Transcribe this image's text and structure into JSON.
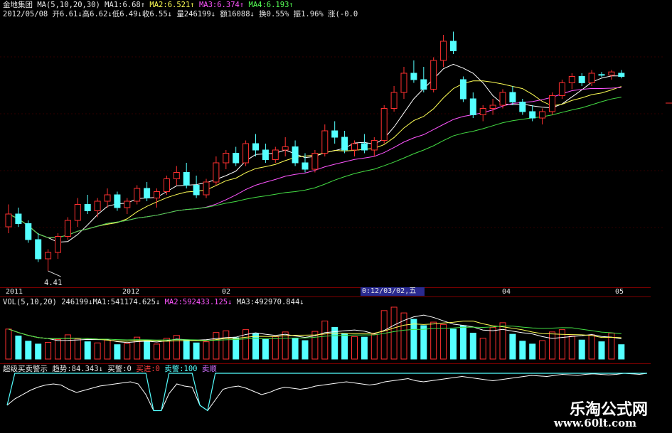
{
  "header": {
    "stock_name": "金地集团",
    "ma_label": "MA(5,10,20,30)",
    "ma1": "MA1:6.68↑",
    "ma2": "MA2:6.521↑",
    "ma3": "MA3:6.374↑",
    "ma4": "MA4:6.193↑",
    "date": "2012/05/08",
    "open": "开6.61↓",
    "high": "高6.62↓",
    "low": "低6.49↓",
    "close": "收6.55↓",
    "volume": "量246199↓",
    "amount": "额16088↓",
    "turnover": "换0.55%",
    "amplitude": "振1.96%",
    "rise": "涨(-0.0"
  },
  "axis": {
    "dates": [
      "2011",
      "2012",
      "02",
      "04",
      "05"
    ],
    "cursor_date": "0:12/03/02,五",
    "low_marker": "4.41"
  },
  "volume_header": {
    "label": "VOL(5,10,20)",
    "value": "246199↓",
    "ma1": "MA1:541174.625↓",
    "ma2": "MA2:592433.125↓",
    "ma3": "MA3:492970.844↓"
  },
  "indicator_header": {
    "name": "超级买卖警示",
    "trend": "趋势:84.343↓",
    "buy_alert": "买警:0",
    "buy": "买进:0",
    "sell_alert": "卖警:100",
    "sell": "卖顺"
  },
  "watermark": {
    "title": "乐淘公式网",
    "url": "www.60lt.com"
  },
  "colors": {
    "up": "#ff3030",
    "down": "#54ffff",
    "ma5": "#ffffff",
    "ma10": "#ffff55",
    "ma20": "#ff55ff",
    "ma30": "#44dd44",
    "trend_line": "#ffffff",
    "signal_line": "#54ffff"
  },
  "chart_data": {
    "type": "candlestick",
    "ylim": [
      4.2,
      8.2
    ],
    "candles": [
      [
        5.1,
        5.45,
        5.0,
        5.3
      ],
      [
        5.3,
        5.4,
        5.1,
        5.15
      ],
      [
        5.15,
        5.2,
        4.85,
        4.9
      ],
      [
        4.9,
        5.0,
        4.55,
        4.6
      ],
      [
        4.6,
        4.75,
        4.41,
        4.7
      ],
      [
        4.7,
        5.0,
        4.6,
        4.95
      ],
      [
        4.95,
        5.25,
        4.9,
        5.2
      ],
      [
        5.2,
        5.55,
        5.1,
        5.45
      ],
      [
        5.45,
        5.6,
        5.3,
        5.35
      ],
      [
        5.35,
        5.55,
        5.25,
        5.5
      ],
      [
        5.5,
        5.7,
        5.4,
        5.6
      ],
      [
        5.6,
        5.65,
        5.35,
        5.4
      ],
      [
        5.4,
        5.55,
        5.3,
        5.5
      ],
      [
        5.5,
        5.75,
        5.45,
        5.7
      ],
      [
        5.7,
        5.8,
        5.5,
        5.55
      ],
      [
        5.55,
        5.7,
        5.4,
        5.65
      ],
      [
        5.65,
        5.9,
        5.6,
        5.85
      ],
      [
        5.85,
        6.05,
        5.75,
        5.95
      ],
      [
        5.95,
        6.1,
        5.7,
        5.75
      ],
      [
        5.75,
        5.9,
        5.55,
        5.6
      ],
      [
        5.6,
        5.85,
        5.55,
        5.8
      ],
      [
        5.8,
        6.2,
        5.75,
        6.1
      ],
      [
        6.1,
        6.3,
        6.0,
        6.25
      ],
      [
        6.25,
        6.35,
        6.05,
        6.1
      ],
      [
        6.1,
        6.45,
        6.05,
        6.4
      ],
      [
        6.4,
        6.55,
        6.2,
        6.3
      ],
      [
        6.3,
        6.4,
        6.1,
        6.15
      ],
      [
        6.15,
        6.35,
        6.1,
        6.3
      ],
      [
        6.3,
        6.5,
        6.2,
        6.35
      ],
      [
        6.35,
        6.45,
        6.05,
        6.1
      ],
      [
        6.1,
        6.25,
        5.95,
        6.0
      ],
      [
        6.0,
        6.3,
        5.95,
        6.25
      ],
      [
        6.25,
        6.7,
        6.2,
        6.6
      ],
      [
        6.6,
        6.75,
        6.4,
        6.5
      ],
      [
        6.5,
        6.6,
        6.25,
        6.3
      ],
      [
        6.3,
        6.45,
        6.2,
        6.4
      ],
      [
        6.4,
        6.55,
        6.25,
        6.3
      ],
      [
        6.3,
        6.5,
        6.2,
        6.45
      ],
      [
        6.45,
        7.0,
        6.4,
        6.95
      ],
      [
        6.95,
        7.3,
        6.9,
        7.2
      ],
      [
        7.2,
        7.6,
        7.1,
        7.5
      ],
      [
        7.5,
        7.7,
        7.35,
        7.4
      ],
      [
        7.4,
        7.6,
        7.2,
        7.25
      ],
      [
        7.25,
        7.75,
        7.2,
        7.7
      ],
      [
        7.7,
        8.1,
        7.6,
        8.0
      ],
      [
        8.0,
        8.15,
        7.8,
        7.85
      ],
      [
        7.4,
        7.45,
        7.05,
        7.1
      ],
      [
        7.1,
        7.2,
        6.8,
        6.85
      ],
      [
        6.85,
        7.0,
        6.75,
        6.95
      ],
      [
        6.95,
        7.1,
        6.85,
        7.0
      ],
      [
        7.0,
        7.25,
        6.95,
        7.2
      ],
      [
        7.2,
        7.3,
        7.0,
        7.05
      ],
      [
        7.05,
        7.1,
        6.85,
        6.9
      ],
      [
        6.9,
        7.0,
        6.75,
        6.8
      ],
      [
        6.8,
        6.95,
        6.7,
        6.9
      ],
      [
        6.9,
        7.2,
        6.85,
        7.15
      ],
      [
        7.15,
        7.4,
        7.1,
        7.35
      ],
      [
        7.35,
        7.5,
        7.25,
        7.45
      ],
      [
        7.45,
        7.5,
        7.3,
        7.35
      ],
      [
        7.35,
        7.55,
        7.3,
        7.5
      ],
      [
        7.48,
        7.52,
        7.44,
        7.47
      ],
      [
        7.47,
        7.55,
        7.4,
        7.52
      ],
      [
        7.5,
        7.55,
        7.42,
        7.45
      ]
    ],
    "volume": [
      5.2,
      4.0,
      3.1,
      2.6,
      2.9,
      3.4,
      4.2,
      3.5,
      3.0,
      2.8,
      3.3,
      2.5,
      2.7,
      3.8,
      3.2,
      2.6,
      3.6,
      4.1,
      3.3,
      2.8,
      3.0,
      4.6,
      4.9,
      3.7,
      5.1,
      4.4,
      3.4,
      3.9,
      4.7,
      3.6,
      3.2,
      4.8,
      6.6,
      5.5,
      4.4,
      3.9,
      3.8,
      4.3,
      8.4,
      9.0,
      8.0,
      6.9,
      5.8,
      6.4,
      6.0,
      5.2,
      5.8,
      4.5,
      3.6,
      5.5,
      6.3,
      4.3,
      3.1,
      2.6,
      3.2,
      4.7,
      5.1,
      4.0,
      3.3,
      4.2,
      3.0,
      4.5,
      2.5
    ],
    "trend": [
      40,
      52,
      60,
      68,
      74,
      78,
      80,
      78,
      70,
      64,
      68,
      72,
      76,
      78,
      80,
      82,
      84,
      80,
      60,
      30,
      30,
      62,
      80,
      76,
      74,
      40,
      30,
      50,
      70,
      74,
      76,
      72,
      66,
      60,
      64,
      70,
      74,
      72,
      70,
      72,
      76,
      78,
      80,
      82,
      84,
      82,
      80,
      78,
      80,
      84,
      86,
      88,
      90,
      86,
      84,
      86,
      88,
      90,
      92,
      94,
      92,
      90,
      88,
      86,
      88,
      90,
      92,
      94,
      96,
      95,
      94,
      96,
      98,
      97,
      96,
      98,
      99,
      98,
      97,
      98,
      100,
      99,
      98,
      100
    ]
  }
}
